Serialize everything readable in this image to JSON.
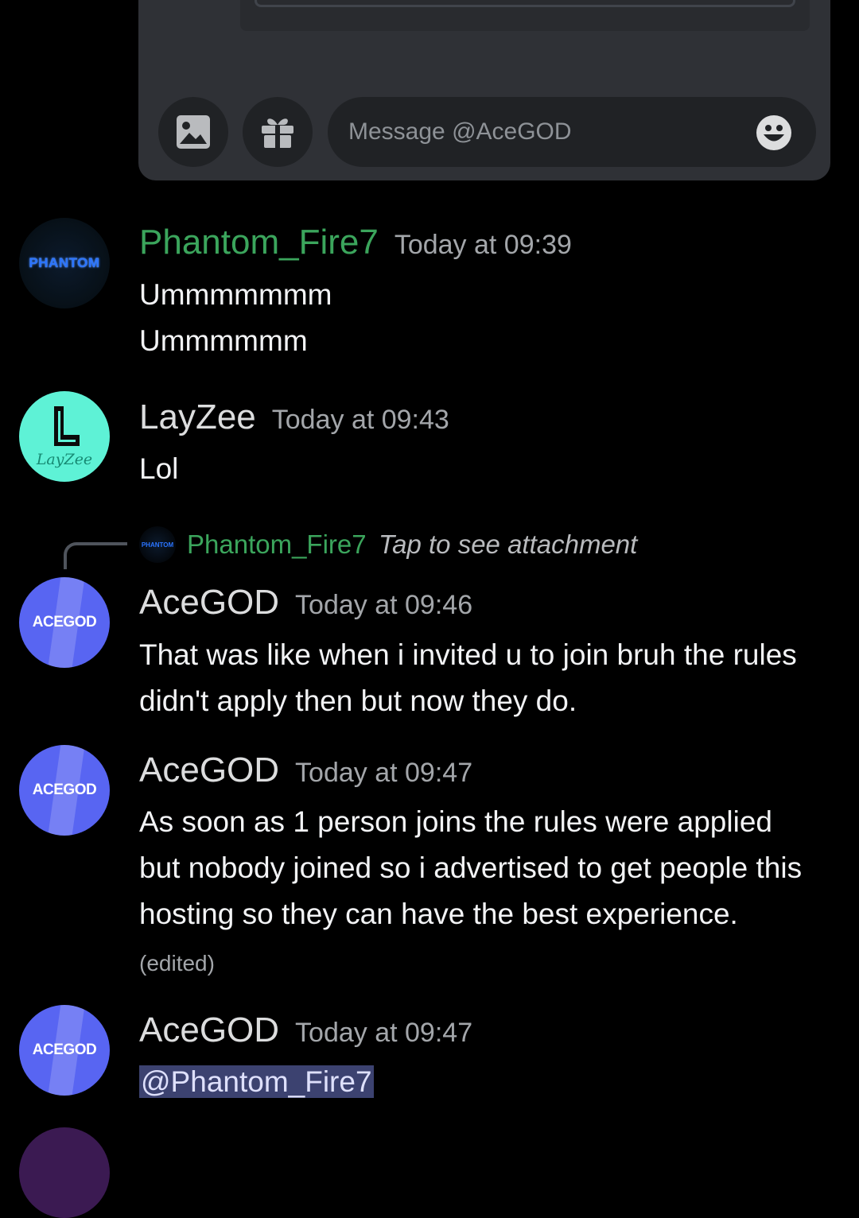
{
  "composer": {
    "placeholder": "Message @AceGOD",
    "icons": [
      "image-icon",
      "gift-icon",
      "emoji-icon"
    ]
  },
  "messages": [
    {
      "author": "Phantom_Fire7",
      "author_color": "#3ba55c",
      "avatar_text": "PHANTOM",
      "timestamp": "Today at 09:39",
      "lines": [
        "Ummmmmmm",
        "Ummmmmm"
      ]
    },
    {
      "author": "LayZee",
      "author_color": "#dcddde",
      "avatar_text": "LayZee",
      "timestamp": "Today at 09:43",
      "lines": [
        "Lol"
      ]
    },
    {
      "reply": {
        "author": "Phantom_Fire7",
        "avatar_text": "PHANTOM",
        "text": "Tap to see attachment"
      },
      "author": "AceGOD",
      "avatar_text": "ACEGOD",
      "timestamp": "Today at 09:46",
      "lines": [
        "That was like when i invited u to join bruh the rules",
        "didn't apply then but now they do."
      ]
    },
    {
      "author": "AceGOD",
      "avatar_text": "ACEGOD",
      "timestamp": "Today at 09:47",
      "lines": [
        "As soon as 1 person joins the rules were applied",
        "but nobody joined so i advertised to get people this",
        "hosting so they can have the best experience."
      ],
      "edited": "(edited)"
    },
    {
      "author": "AceGOD",
      "avatar_text": "ACEGOD",
      "timestamp": "Today at 09:47",
      "mention": "@Phantom_Fire7"
    }
  ],
  "colors": {
    "background": "#000000",
    "composer_bg": "#2f3136",
    "blurple": "#5865f2",
    "green": "#3ba55c",
    "mention_bg": "#3c4270"
  }
}
